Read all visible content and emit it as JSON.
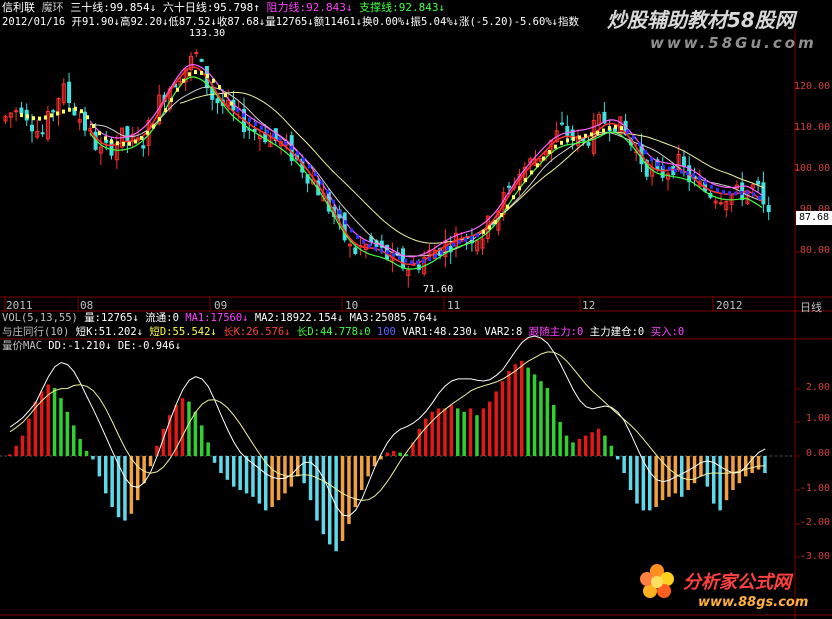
{
  "header": {
    "stock_name": "信利联",
    "indicator_name": "魔环",
    "ma30_label": "三十线:99.854↓",
    "ma60_label": "六十日线:95.798↑",
    "resistance_label": "阻力线:92.843↓",
    "support_label": "支撑线:92.843↓",
    "ohlc_line": "2012/01/16 开91.90↓高92.20↓低87.52↓收87.68↓量12765↓额11461↓换0.00%↓振5.04%↓涨(-5.20)-5.60%↓指数"
  },
  "watermark": {
    "top_text": "炒股辅助教材58股网",
    "top_url": "www.58Gu.com",
    "bottom_text": "分析家公式网",
    "bottom_url": "www.88gs.com"
  },
  "main_axis": {
    "labels": [
      "120.00",
      "110.00",
      "100.00",
      "90.00",
      "80.00"
    ],
    "current_price": "87.68",
    "high_label": "133.30",
    "low_label": "71.60"
  },
  "date_axis": [
    "2011",
    "08",
    "09",
    "10",
    "11",
    "12",
    "2012"
  ],
  "date_axis_unit": "日线",
  "vol_panel": {
    "title": "VOL(5,13,55)",
    "vol": "量:12765↓",
    "float": "流通:0",
    "ma1": "MA1:17560↓",
    "ma2": "MA2:18922.154↓",
    "ma3": "MA3:25085.764↓"
  },
  "follow_panel": {
    "title": "与庄同行(10)",
    "short_k": "短K:51.202↓",
    "short_d": "短D:55.542↓",
    "long_k": "长K:26.576↓",
    "long_d": "长D:44.778↓0",
    "val100": "100",
    "var1": "VAR1:48.230↓",
    "var2": "VAR2:8",
    "follow_main": "跟随主力:0",
    "build": "主力建仓:0",
    "buy": "买入:0"
  },
  "macd_panel": {
    "title": "量价MAC",
    "dd": "DD:-1.210↓",
    "de": "DE:-0.946↓",
    "axis": [
      "2.00",
      "1.00",
      "0.00",
      "-1.00",
      "-2.00",
      "-3.00"
    ]
  },
  "colors": {
    "up": "#ff3030",
    "down": "#40e0e0",
    "grid": "#800000",
    "macd_pos_red": "#e01818",
    "macd_pos_green": "#30d030",
    "macd_neg_cyan": "#60d8e8",
    "macd_neg_orange": "#f0a040"
  },
  "chart_data": {
    "type": "bar",
    "macd_histogram": [
      0.05,
      0.3,
      0.6,
      1.1,
      1.6,
      1.9,
      2.1,
      2.0,
      1.7,
      1.3,
      0.9,
      0.5,
      0.15,
      -0.1,
      -0.6,
      -1.1,
      -1.5,
      -1.8,
      -1.9,
      -1.7,
      -1.3,
      -0.8,
      -0.3,
      0.3,
      0.8,
      1.2,
      1.5,
      1.7,
      1.6,
      1.3,
      0.9,
      0.4,
      -0.2,
      -0.5,
      -0.7,
      -0.9,
      -1.0,
      -1.1,
      -1.2,
      -1.4,
      -1.6,
      -1.5,
      -1.3,
      -1.1,
      -0.9,
      -0.6,
      -0.8,
      -1.3,
      -1.9,
      -2.3,
      -2.6,
      -2.8,
      -2.5,
      -2.0,
      -1.5,
      -1.0,
      -0.6,
      -0.3,
      -0.1,
      0.1,
      0.15,
      0.1,
      0.05,
      0.4,
      0.8,
      1.1,
      1.3,
      1.4,
      1.4,
      1.5,
      1.4,
      1.3,
      1.4,
      1.2,
      1.4,
      1.6,
      1.9,
      2.2,
      2.5,
      2.7,
      2.8,
      2.6,
      2.4,
      2.2,
      2.0,
      1.5,
      1.0,
      0.6,
      0.4,
      0.5,
      0.6,
      0.7,
      0.8,
      0.6,
      0.3,
      -0.1,
      -0.5,
      -1.0,
      -1.4,
      -1.6,
      -1.6,
      -1.5,
      -1.3,
      -1.2,
      -1.1,
      -1.2,
      -1.0,
      -0.8,
      -0.6,
      -0.9,
      -1.4,
      -1.6,
      -1.3,
      -1.0,
      -0.8,
      -0.6,
      -0.5,
      -0.4,
      -0.5
    ]
  }
}
